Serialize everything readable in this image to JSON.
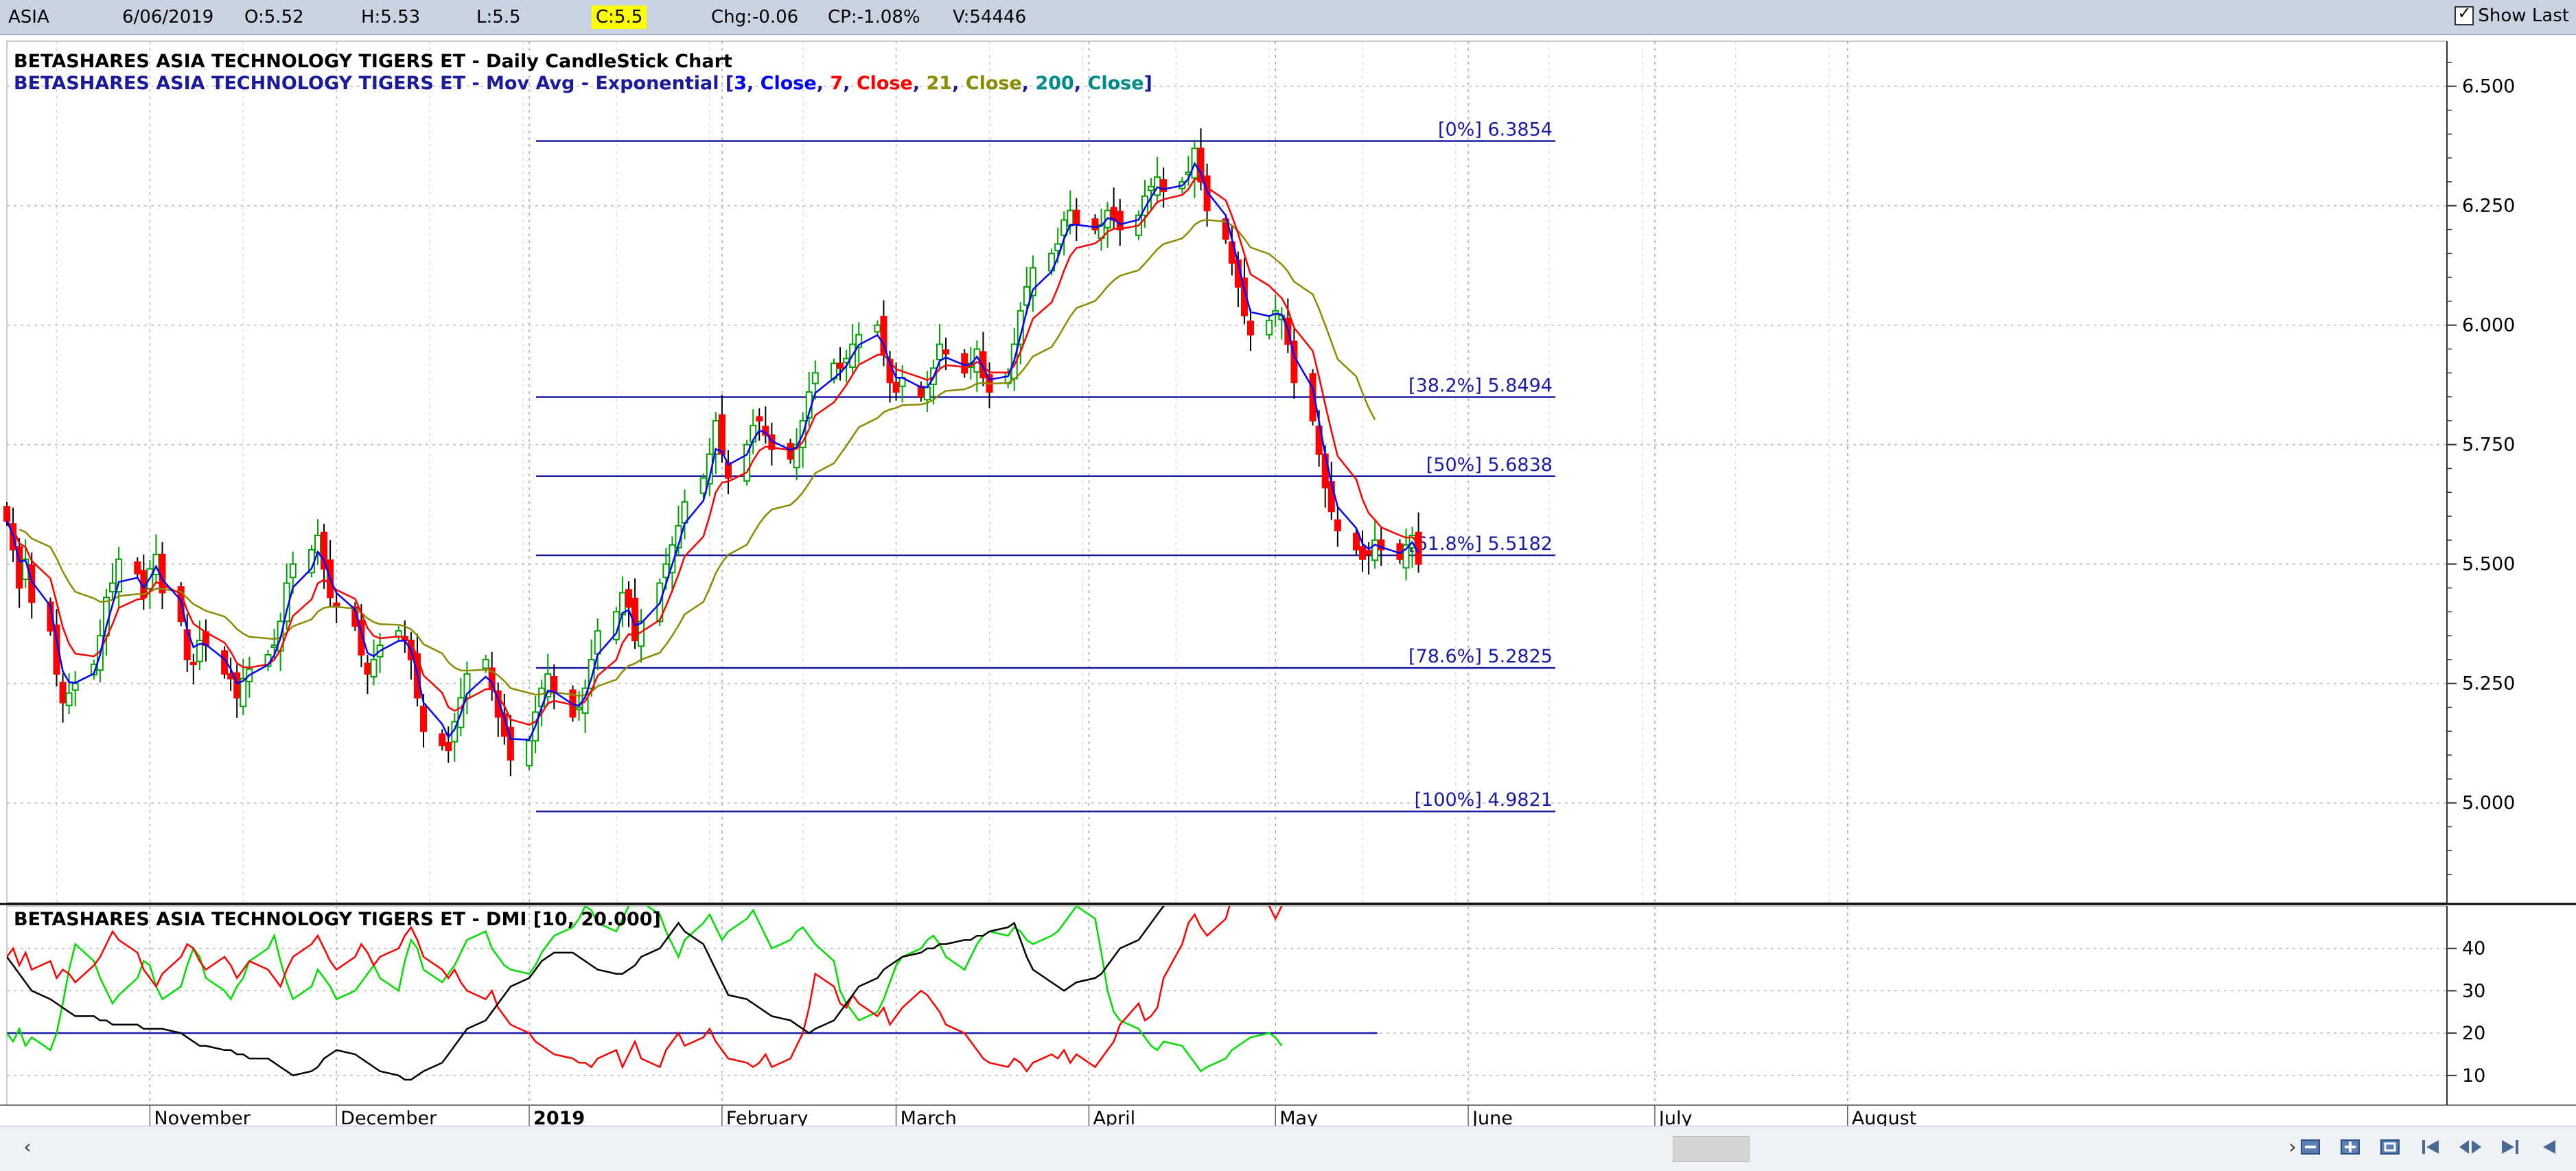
{
  "topbar": {
    "symbol": "ASIA",
    "date": "6/06/2019",
    "open": "O:5.52",
    "high": "H:5.53",
    "low": "L:5.5",
    "close": "C:5.5",
    "change": "Chg:-0.06",
    "change_pct": "CP:-1.08%",
    "volume": "V:54446",
    "show_last": "Show Last",
    "highlight_color": "#ffff00"
  },
  "chart_data": [
    {
      "type": "candlestick",
      "title": "BETASHARES ASIA TECHNOLOGY TIGERS ET - Daily CandleStick Chart",
      "overlay": {
        "prefix": "BETASHARES ASIA TECHNOLOGY TIGERS ET - Mov Avg - Exponential [",
        "params": [
          {
            "period": "3",
            "field": "Close",
            "color": "#0000ff"
          },
          {
            "period": "7",
            "field": "Close",
            "color": "#ff0000"
          },
          {
            "period": "21",
            "field": "Close",
            "color": "#8b8b00"
          },
          {
            "period": "200",
            "field": "Close",
            "color": "#008b8b"
          }
        ],
        "suffix": "]"
      },
      "y_ticks": [
        "6.500",
        "6.250",
        "6.000",
        "5.750",
        "5.500",
        "5.250",
        "5.000"
      ],
      "ylim": [
        4.82,
        6.58
      ],
      "up_color": "#00a000",
      "down_color": "#ff0000",
      "fib_color": "#1a1aa8",
      "fib_levels": [
        {
          "label": "[0%] 6.3854",
          "value": 6.3854
        },
        {
          "label": "[38.2%] 5.8494",
          "value": 5.8494
        },
        {
          "label": "[50%] 5.6838",
          "value": 5.6838
        },
        {
          "label": "[61.8%] 5.5182",
          "value": 5.5182
        },
        {
          "label": "[78.6%] 5.2825",
          "value": 5.2825
        },
        {
          "label": "[100%] 4.9821",
          "value": 4.9821
        }
      ],
      "closes": [
        5.59,
        5.53,
        5.45,
        5.51,
        5.42,
        5.36,
        5.27,
        5.21,
        5.23,
        5.25,
        5.29,
        5.35,
        5.43,
        5.46,
        5.51,
        5.48,
        5.43,
        5.49,
        5.52,
        5.44,
        5.38,
        5.3,
        5.29,
        5.34,
        5.33,
        5.27,
        5.26,
        5.22,
        5.26,
        5.28,
        5.31,
        5.33,
        5.38,
        5.46,
        5.5,
        5.53,
        5.56,
        5.49,
        5.43,
        5.41,
        5.37,
        5.31,
        5.27,
        5.3,
        5.33,
        5.36,
        5.34,
        5.3,
        5.22,
        5.15,
        5.12,
        5.11,
        5.17,
        5.22,
        5.27,
        5.3,
        5.24,
        5.18,
        5.14,
        5.09,
        5.13,
        5.19,
        5.24,
        5.27,
        5.23,
        5.18,
        5.2,
        5.24,
        5.3,
        5.36,
        5.4,
        5.44,
        5.41,
        5.34,
        5.38,
        5.46,
        5.5,
        5.54,
        5.58,
        5.63,
        5.68,
        5.73,
        5.8,
        5.73,
        5.68,
        5.75,
        5.79,
        5.8,
        5.77,
        5.74,
        5.72,
        5.75,
        5.8,
        5.86,
        5.9,
        5.92,
        5.91,
        5.93,
        5.96,
        5.98,
        6.0,
        5.94,
        5.88,
        5.86,
        5.89,
        5.85,
        5.87,
        5.91,
        5.96,
        5.94,
        5.9,
        5.92,
        5.95,
        5.89,
        5.86,
        5.9,
        5.96,
        6.03,
        6.08,
        6.12,
        6.15,
        6.17,
        6.22,
        6.24,
        6.21,
        6.2,
        6.21,
        6.24,
        6.22,
        6.2,
        6.23,
        6.27,
        6.29,
        6.31,
        6.28,
        6.3,
        6.32,
        6.37,
        6.3,
        6.24,
        6.18,
        6.13,
        6.08,
        6.02,
        5.98,
        6.01,
        6.03,
        6.02,
        5.96,
        5.88,
        5.8,
        5.73,
        5.66,
        5.61,
        5.57,
        5.53,
        5.51,
        5.52,
        5.55,
        5.53,
        5.51,
        5.54,
        5.56,
        5.5
      ],
      "xlabels": [
        {
          "label": "November",
          "bold": false,
          "day": 23
        },
        {
          "label": "December",
          "bold": false,
          "day": 53
        },
        {
          "label": "2019",
          "bold": true,
          "day": 84
        },
        {
          "label": "February",
          "bold": false,
          "day": 115
        },
        {
          "label": "March",
          "bold": false,
          "day": 143
        },
        {
          "label": "April",
          "bold": false,
          "day": 174
        },
        {
          "label": "May",
          "bold": false,
          "day": 204
        },
        {
          "label": "June",
          "bold": false,
          "day": 235
        },
        {
          "label": "July",
          "bold": false,
          "day": 265
        },
        {
          "label": "August",
          "bold": false,
          "day": 296
        }
      ]
    },
    {
      "type": "line",
      "title": "BETASHARES ASIA TECHNOLOGY TIGERS ET - DMI [10, 20.000]",
      "y_ticks": [
        "40",
        "30",
        "20",
        "10"
      ],
      "ylim": [
        3,
        50
      ],
      "threshold": 20,
      "series": [
        {
          "color": "#00dd00",
          "values": [
            20,
            18,
            21,
            17,
            19,
            16,
            20,
            27,
            35,
            41,
            37,
            33,
            30,
            27,
            29,
            33,
            37,
            36,
            31,
            28,
            31,
            36,
            40,
            38,
            33,
            30,
            28,
            31,
            33,
            37,
            40,
            43,
            37,
            32,
            28,
            31,
            35,
            33,
            31,
            28,
            30,
            32,
            34,
            36,
            33,
            30,
            37,
            42,
            40,
            35,
            32,
            34,
            36,
            39,
            42,
            44,
            40,
            38,
            36,
            35,
            34,
            36,
            39,
            41,
            43,
            45,
            47,
            50,
            49,
            46,
            44,
            47,
            50,
            52,
            51,
            48,
            44,
            41,
            38,
            42,
            46,
            48,
            45,
            42,
            44,
            47,
            49,
            46,
            43,
            40,
            42,
            44,
            45,
            43,
            41,
            37,
            30,
            27,
            25,
            23,
            25,
            28,
            32,
            36,
            38,
            40,
            42,
            43,
            41,
            38,
            35,
            38,
            41,
            43,
            44,
            43,
            45,
            44,
            42,
            41,
            43,
            44,
            46,
            48,
            50,
            47,
            39,
            30,
            25,
            23,
            21,
            19,
            17,
            16,
            18,
            17,
            15,
            13,
            11,
            12,
            14,
            16,
            17,
            18,
            19,
            20,
            19,
            17
          ]
        },
        {
          "color": "#ff0000",
          "values": [
            38,
            40,
            36,
            39,
            35,
            37,
            33,
            35,
            34,
            32,
            36,
            38,
            41,
            44,
            42,
            39,
            35,
            33,
            31,
            34,
            38,
            41,
            40,
            37,
            35,
            38,
            36,
            33,
            35,
            37,
            35,
            33,
            31,
            35,
            38,
            41,
            43,
            40,
            37,
            35,
            38,
            41,
            39,
            36,
            38,
            40,
            43,
            45,
            42,
            38,
            35,
            33,
            35,
            32,
            30,
            28,
            30,
            26,
            24,
            22,
            20,
            18,
            17,
            16,
            15,
            14,
            13,
            13,
            12,
            14,
            16,
            12,
            15,
            18,
            14,
            12,
            16,
            18,
            20,
            17,
            19,
            21,
            18,
            16,
            14,
            13,
            12,
            13,
            15,
            12,
            14,
            17,
            20,
            26,
            34,
            31,
            27,
            26,
            29,
            27,
            24,
            26,
            22,
            24,
            26,
            30,
            29,
            27,
            25,
            22,
            20,
            18,
            16,
            14,
            13,
            12,
            14,
            13,
            11,
            13,
            15,
            14,
            16,
            13,
            15,
            12,
            14,
            16,
            18,
            22,
            27,
            23,
            24,
            26,
            33,
            41,
            46,
            48,
            45,
            43,
            47,
            52,
            55,
            57,
            53,
            50,
            47,
            50
          ]
        },
        {
          "color": "#000000",
          "values": [
            38,
            36,
            34,
            32,
            30,
            28,
            27,
            26,
            25,
            24,
            24,
            23,
            23,
            22,
            22,
            22,
            21,
            21,
            21,
            21,
            20,
            19,
            18,
            17,
            17,
            16,
            16,
            15,
            15,
            14,
            14,
            13,
            12,
            11,
            10,
            11,
            12,
            14,
            15,
            16,
            15,
            14,
            13,
            12,
            11,
            10,
            9,
            9,
            10,
            11,
            13,
            15,
            17,
            19,
            21,
            23,
            25,
            27,
            29,
            31,
            33,
            35,
            37,
            38,
            39,
            39,
            38,
            37,
            36,
            35,
            34,
            34,
            35,
            36,
            38,
            40,
            42,
            44,
            46,
            44,
            41,
            38,
            35,
            32,
            29,
            28,
            27,
            26,
            25,
            24,
            23,
            22,
            21,
            20,
            21,
            23,
            25,
            27,
            29,
            31,
            33,
            35,
            36,
            37,
            38,
            39,
            40,
            40,
            41,
            41,
            42,
            42,
            43,
            43,
            44,
            45,
            46,
            42,
            38,
            35,
            32,
            31,
            30,
            31,
            32,
            33,
            34,
            36,
            38,
            40,
            42,
            44,
            46,
            48,
            50,
            52,
            54,
            56,
            58,
            60,
            62,
            64,
            66,
            68,
            70,
            72,
            74,
            76
          ]
        }
      ]
    }
  ]
}
